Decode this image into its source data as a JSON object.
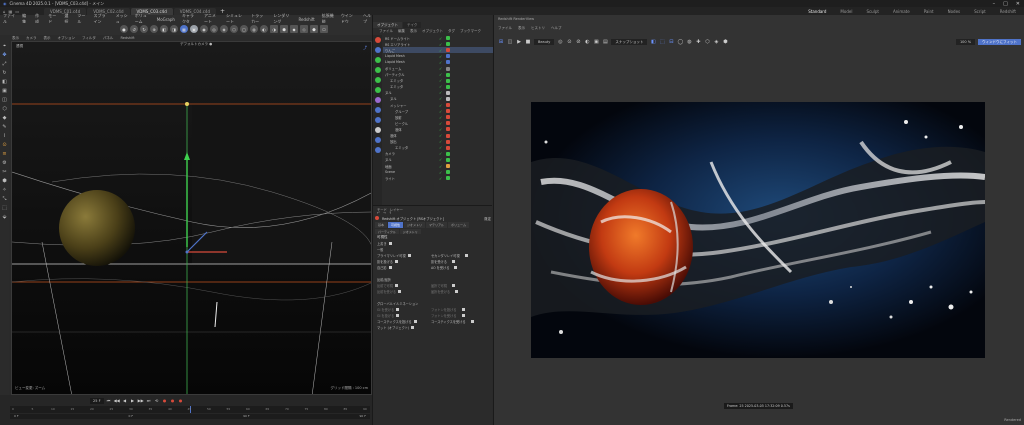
{
  "window": {
    "title": "Cinema 4D 2025.0.1 - [VDMS_C03.c4d] - メイン",
    "controls": [
      "–",
      "□",
      "✕"
    ]
  },
  "doc_tabs": [
    {
      "label": "VDMS_C01.c4d",
      "active": false
    },
    {
      "label": "VDMS_C02.c4d",
      "active": false
    },
    {
      "label": "VDMS_C03.c4d",
      "active": true
    },
    {
      "label": "VDMS_C04.c4d",
      "active": false
    }
  ],
  "layouts": [
    {
      "label": "Standard",
      "current": true
    },
    {
      "label": "Model",
      "current": false
    },
    {
      "label": "Sculpt",
      "current": false
    },
    {
      "label": "Animate",
      "current": false
    },
    {
      "label": "Paint",
      "current": false
    },
    {
      "label": "Nodes",
      "current": false
    },
    {
      "label": "Script",
      "current": false
    },
    {
      "label": "Redshift",
      "current": false
    }
  ],
  "menu": [
    "ファイル",
    "編集",
    "作成",
    "モード",
    "選択",
    "ツール",
    "スプライン",
    "メッシュ",
    "ボリューム",
    "MoGraph",
    "キャラクタ",
    "アニメート",
    "シミュレート",
    "トラッカー",
    "レンダリング",
    "Redshift",
    "拡張機能",
    "ウインドウ",
    "ヘルプ"
  ],
  "toolbar": [
    "●",
    "↺",
    "↻",
    "⊕",
    "◧",
    "◨",
    "▦",
    "▣",
    "◉",
    "◎",
    "◈",
    "⬡",
    "▢",
    "◍",
    "◐",
    "◑",
    "⬢",
    "◆",
    "◇",
    "⬟",
    "⬠"
  ],
  "viewport": {
    "menu": [
      "表示",
      "カメラ",
      "表示",
      "オプション",
      "フィルタ",
      "パネル",
      "Redshift"
    ],
    "label": "透視",
    "camera_label": "デフォルトカメラ ●",
    "footer_left": "ビュー変更: ズーム",
    "footer_right": "グリッド間隔 : 100 cm"
  },
  "palette": [
    "⌖",
    "✥",
    "⤢",
    "↻",
    "◧",
    "▣",
    "◫",
    "⬡",
    "◆",
    "✎",
    "⌇",
    "⊙",
    "≡",
    "⚙",
    "✂",
    "⬢",
    "✧",
    "⤡",
    "⬚",
    "⬙"
  ],
  "timeline": {
    "current_frame": "25 F",
    "ticks": [
      "0",
      "5",
      "10",
      "15",
      "20",
      "25",
      "30",
      "35",
      "40",
      "45",
      "50",
      "55",
      "60",
      "65",
      "70",
      "75",
      "80",
      "85",
      "90"
    ],
    "range_start": "0 F",
    "range_mid_a": "0 F",
    "range_mid_b": "90 F",
    "range_end": "90 F",
    "controls": [
      "⏮",
      "◀◀",
      "◀",
      "▶",
      "▶▶",
      "⏭",
      "⟲"
    ]
  },
  "object_manager": {
    "tabs": [
      {
        "label": "オブジェクト",
        "active": true
      },
      {
        "label": "テイク",
        "active": false
      }
    ],
    "menu": [
      "ファイル",
      "編集",
      "表示",
      "オブジェクト",
      "タグ",
      "ブックマーク"
    ],
    "rows": [
      {
        "name": "RS ドームライト",
        "indent": 0,
        "sel": false,
        "tag": "#3cc04a"
      },
      {
        "name": "RS エリアライト",
        "indent": 0,
        "sel": false,
        "tag": "#3cc04a"
      },
      {
        "name": "りんご",
        "indent": 0,
        "sel": true,
        "tag": "#d74a3a"
      },
      {
        "name": "Liquid Mesh",
        "indent": 0,
        "sel": false,
        "tag": "#4f73c9"
      },
      {
        "name": "Liquid Mesh",
        "indent": 0,
        "sel": false,
        "tag": "#4f73c9"
      },
      {
        "name": "ボリューム",
        "indent": 0,
        "sel": false,
        "tag": "#888888"
      },
      {
        "name": "パーティクル",
        "indent": 0,
        "sel": false,
        "tag": "#3cc04a"
      },
      {
        "name": "エミッタ",
        "indent": 1,
        "sel": false,
        "tag": "#3cc04a"
      },
      {
        "name": "エミッタ",
        "indent": 1,
        "sel": false,
        "tag": "#3cc04a"
      },
      {
        "name": "ヌル",
        "indent": 0,
        "sel": false,
        "tag": "#bbbbbb"
      },
      {
        "name": "ヌル",
        "indent": 1,
        "sel": false,
        "tag": "#bbbbbb"
      },
      {
        "name": "メッシャー",
        "indent": 1,
        "sel": false,
        "tag": "#d74a3a"
      },
      {
        "name": "グループ",
        "indent": 2,
        "sel": false,
        "tag": "#d74a3a"
      },
      {
        "name": "放射",
        "indent": 2,
        "sel": false,
        "tag": "#d74a3a"
      },
      {
        "name": "ビークル",
        "indent": 2,
        "sel": false,
        "tag": "#d74a3a"
      },
      {
        "name": "液体",
        "indent": 2,
        "sel": false,
        "tag": "#d74a3a"
      },
      {
        "name": "液体",
        "indent": 1,
        "sel": false,
        "tag": "#d74a3a"
      },
      {
        "name": "放出",
        "indent": 1,
        "sel": false,
        "tag": "#d74a3a"
      },
      {
        "name": "エミッタ",
        "indent": 2,
        "sel": false,
        "tag": "#d74a3a"
      },
      {
        "name": "カメラ",
        "indent": 0,
        "sel": false,
        "tag": "#3cc04a"
      },
      {
        "name": "ヌル",
        "indent": 0,
        "sel": false,
        "tag": "#3cc04a"
      },
      {
        "name": "地面",
        "indent": 0,
        "sel": false,
        "tag": "#e0a040"
      },
      {
        "name": "Scene",
        "indent": 0,
        "sel": false,
        "tag": "#3cc04a"
      },
      {
        "name": "ライト",
        "indent": 0,
        "sel": false,
        "tag": "#3cc04a"
      }
    ]
  },
  "attribute_manager": {
    "tabs": [
      "モード",
      "レイヤー"
    ],
    "menu_nav": [
      "←",
      "→",
      "↑"
    ],
    "object_label": "Redshift オブジェクト [RSオブジェクト]",
    "object_mode": "既定",
    "subtabs": [
      {
        "label": "基本",
        "active": false
      },
      {
        "label": "可視性",
        "active": true
      },
      {
        "label": "ジオメトリ",
        "active": false
      },
      {
        "label": "マテリアル",
        "active": false
      },
      {
        "label": "ボリューム",
        "active": false
      }
    ],
    "subtabs2": [
      "パーティクル",
      "ジオメトリ"
    ],
    "section": "可視性",
    "lines": [
      {
        "label": "上書き",
        "has_box": true,
        "col2": "",
        "dim": false
      },
      {
        "label": "一般",
        "has_box": false,
        "col2": "",
        "dim": false
      },
      {
        "label": "プライマリレイ可視",
        "has_box": true,
        "col2": "セカンダリレイ可視",
        "dim": false
      },
      {
        "label": "影を投げる",
        "has_box": true,
        "col2": "影を受ける",
        "dim": false
      },
      {
        "label": "自己影",
        "has_box": true,
        "col2": "AO を受ける",
        "dim": false
      },
      {
        "label": "",
        "has_box": false,
        "col2": "",
        "dim": false
      },
      {
        "label": "反射/屈折",
        "has_box": false,
        "col2": "",
        "dim": false
      },
      {
        "label": "反射で可視",
        "has_box": true,
        "col2": "屈折で可視",
        "dim": true
      },
      {
        "label": "反射を受ける",
        "has_box": true,
        "col2": "屈折を受ける",
        "dim": true
      },
      {
        "label": "",
        "has_box": false,
        "col2": "",
        "dim": false
      },
      {
        "label": "グローバルイルミネーション",
        "has_box": false,
        "col2": "",
        "dim": false
      },
      {
        "label": "GI を受ける",
        "has_box": true,
        "col2": "フォトンを投げる",
        "dim": true
      },
      {
        "label": "GI を投げる",
        "has_box": true,
        "col2": "フォトンを受ける",
        "dim": true
      },
      {
        "label": "コースティクスを投げる",
        "has_box": true,
        "col2": "コースティクスを受ける",
        "dim": false
      },
      {
        "label": "マット (オブジェクト)",
        "has_box": true,
        "col2": "",
        "dim": false
      }
    ]
  },
  "render_view": {
    "tabs": [
      "Redshift RenderView"
    ],
    "menu": [
      "ファイル",
      "表示",
      "ヒストリ",
      "ヘルプ"
    ],
    "toolbar_left": [
      "⊞",
      "◫",
      "▶",
      "■"
    ],
    "aov_label": "Beauty",
    "toolbar_mid": [
      "◎",
      "⊙",
      "⊘",
      "◐",
      "▣",
      "▤"
    ],
    "snapshot_label": "スナップショット",
    "toolbar_right": [
      "◧",
      "⬚",
      "⊟",
      "◯",
      "◍",
      "✚",
      "⬡",
      "◈",
      "⬢"
    ],
    "zoom_label": "100 %",
    "fit_label": "ウィンドウにフィット",
    "frame_info": "Frame: 25  2025-03-05 17:32:09  0.57s",
    "status": "Rendered"
  }
}
